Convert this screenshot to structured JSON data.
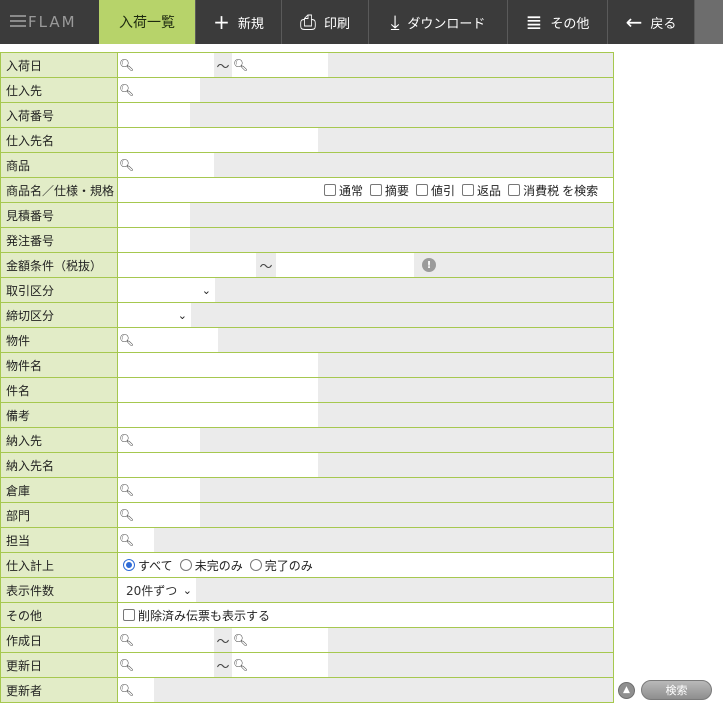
{
  "toolbar": {
    "logo": "FLAM",
    "active_tab": "入荷一覧",
    "buttons": [
      {
        "icon": "+",
        "label": "新規"
      },
      {
        "icon": "⎙",
        "label": "印刷"
      },
      {
        "icon": "⤓",
        "label": "ダウンロード"
      },
      {
        "icon": "≣",
        "label": "その他"
      },
      {
        "icon": "←",
        "label": "戻る"
      }
    ]
  },
  "form": {
    "labels": {
      "arrival_date": "入荷日",
      "supplier": "仕入先",
      "arrival_no": "入荷番号",
      "supplier_name": "仕入先名",
      "product": "商品",
      "product_name_spec": "商品名／仕様・規格",
      "estimate_no": "見積番号",
      "order_no": "発注番号",
      "amount_cond": "金額条件（税抜）",
      "trade_type": "取引区分",
      "closing_type": "締切区分",
      "property": "物件",
      "property_name": "物件名",
      "subject": "件名",
      "note": "備考",
      "delivery_to": "納入先",
      "delivery_to_name": "納入先名",
      "warehouse": "倉庫",
      "department": "部門",
      "staff": "担当",
      "purchase_record": "仕入計上",
      "display_count": "表示件数",
      "other": "その他",
      "created_date": "作成日",
      "updated_date": "更新日",
      "updated_by": "更新者"
    },
    "range_separator": "～",
    "product_checkboxes": [
      "通常",
      "摘要",
      "値引",
      "返品",
      "消費税"
    ],
    "product_search_suffix": "を検索",
    "purchase_record_options": [
      "すべて",
      "未完のみ",
      "完了のみ"
    ],
    "purchase_record_selected": "すべて",
    "display_count_value": "20件ずつ",
    "other_option": "削除済み伝票も表示する",
    "info_glyph": "!"
  },
  "actions": {
    "search_label": "検索",
    "collapse_glyph": "▲"
  }
}
